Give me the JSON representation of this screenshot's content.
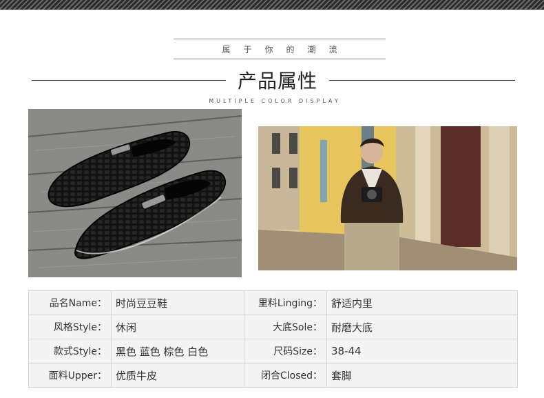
{
  "header": {
    "tagline": "属于你的潮流",
    "title": "产品属性",
    "subtitle": "MULTIPLE COLOR DISPLAY"
  },
  "images": {
    "left": "black-crocodile-loafers-photo",
    "right": "man-with-camera-street-photo"
  },
  "specs": {
    "rows": [
      {
        "l_label": "品名Name：",
        "l_value": "时尚豆豆鞋",
        "r_label": "里料Linging：",
        "r_value": "舒适内里"
      },
      {
        "l_label": "风格Style：",
        "l_value": "休闲",
        "r_label": "大底Sole：",
        "r_value": "耐磨大底"
      },
      {
        "l_label": "款式Style：",
        "l_value": "黑色 蓝色 棕色 白色",
        "r_label": "尺码Size：",
        "r_value": "38-44"
      },
      {
        "l_label": "面料Upper：",
        "l_value": "优质牛皮",
        "r_label": "闭合Closed：",
        "r_value": "套脚"
      }
    ]
  },
  "colors": {
    "band": "#2b2b2b",
    "table_bg": "#f4f4f4",
    "table_border": "#d4d4d4",
    "shoe": "#111111",
    "wall": "#e8c45c"
  }
}
